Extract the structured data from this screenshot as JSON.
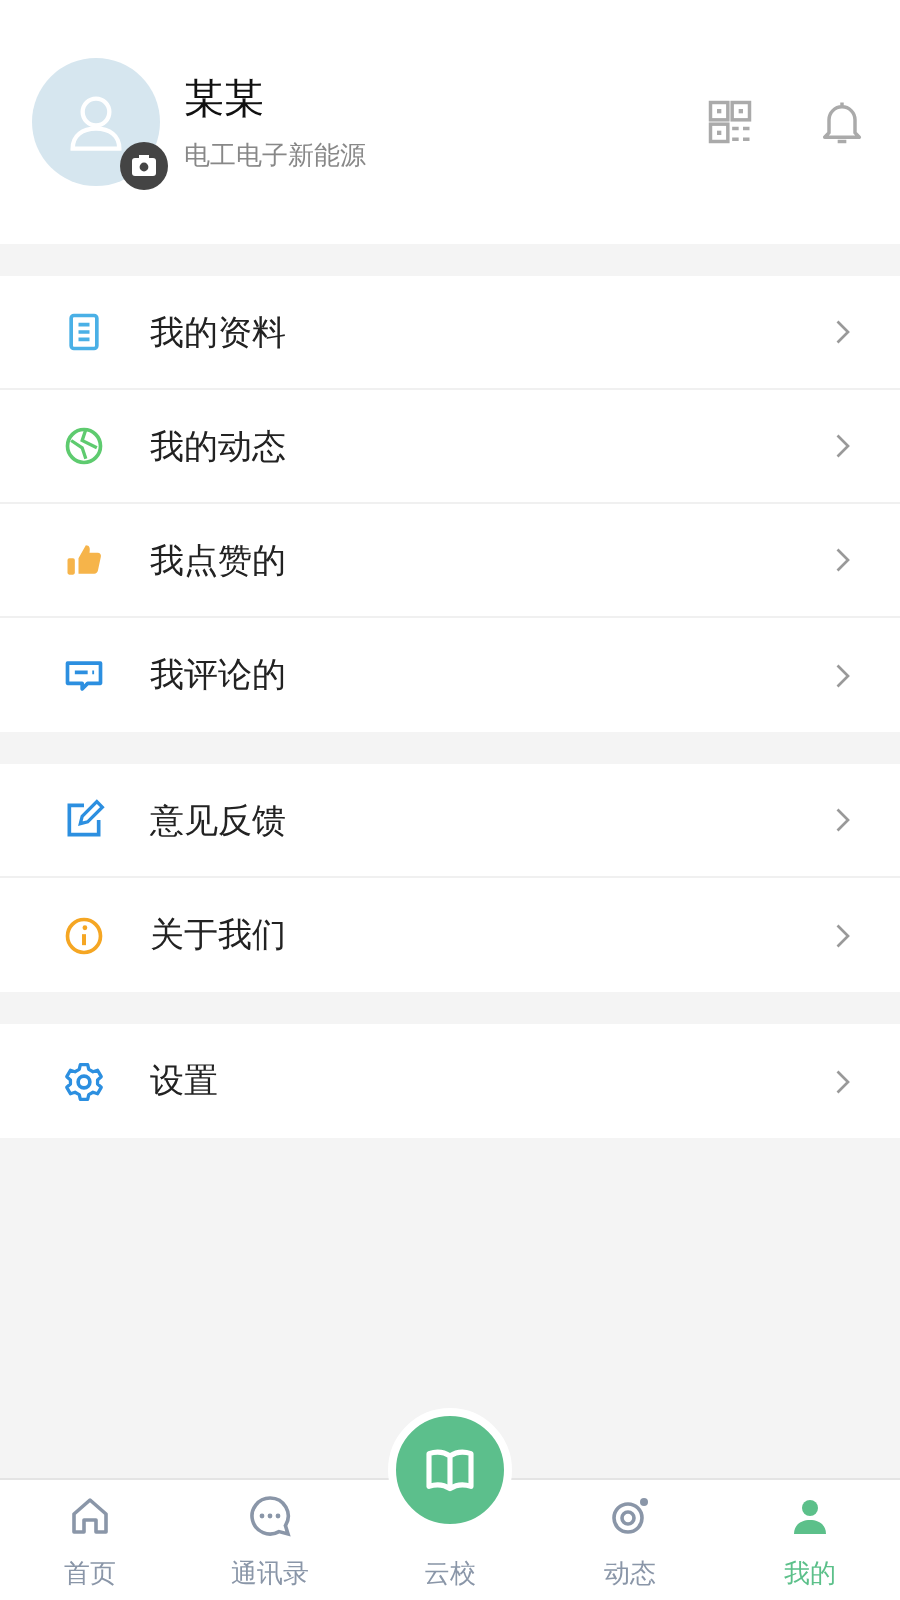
{
  "profile": {
    "name": "某某",
    "subtitle": "电工电子新能源"
  },
  "menu_groups": [
    [
      {
        "kind": "document",
        "color": "#4ab0e6",
        "label": "我的资料"
      },
      {
        "kind": "globe",
        "color": "#5ecb6f",
        "label": "我的动态"
      },
      {
        "kind": "thumb",
        "color": "#f6b44a",
        "label": "我点赞的"
      },
      {
        "kind": "comment",
        "color": "#2c8fe0",
        "label": "我评论的"
      }
    ],
    [
      {
        "kind": "edit",
        "color": "#2c8fe0",
        "label": "意见反馈"
      },
      {
        "kind": "info",
        "color": "#f5a623",
        "label": "关于我们"
      }
    ],
    [
      {
        "kind": "gear",
        "color": "#2c8fe0",
        "label": "设置"
      }
    ]
  ],
  "tab_bar": [
    {
      "kind": "home",
      "label": "首页",
      "selected": false
    },
    {
      "kind": "chat",
      "label": "通讯录",
      "selected": false
    },
    {
      "kind": "book",
      "label": "云校",
      "selected": false
    },
    {
      "kind": "orbit",
      "label": "动态",
      "selected": false
    },
    {
      "kind": "person",
      "label": "我的",
      "selected": true
    }
  ]
}
